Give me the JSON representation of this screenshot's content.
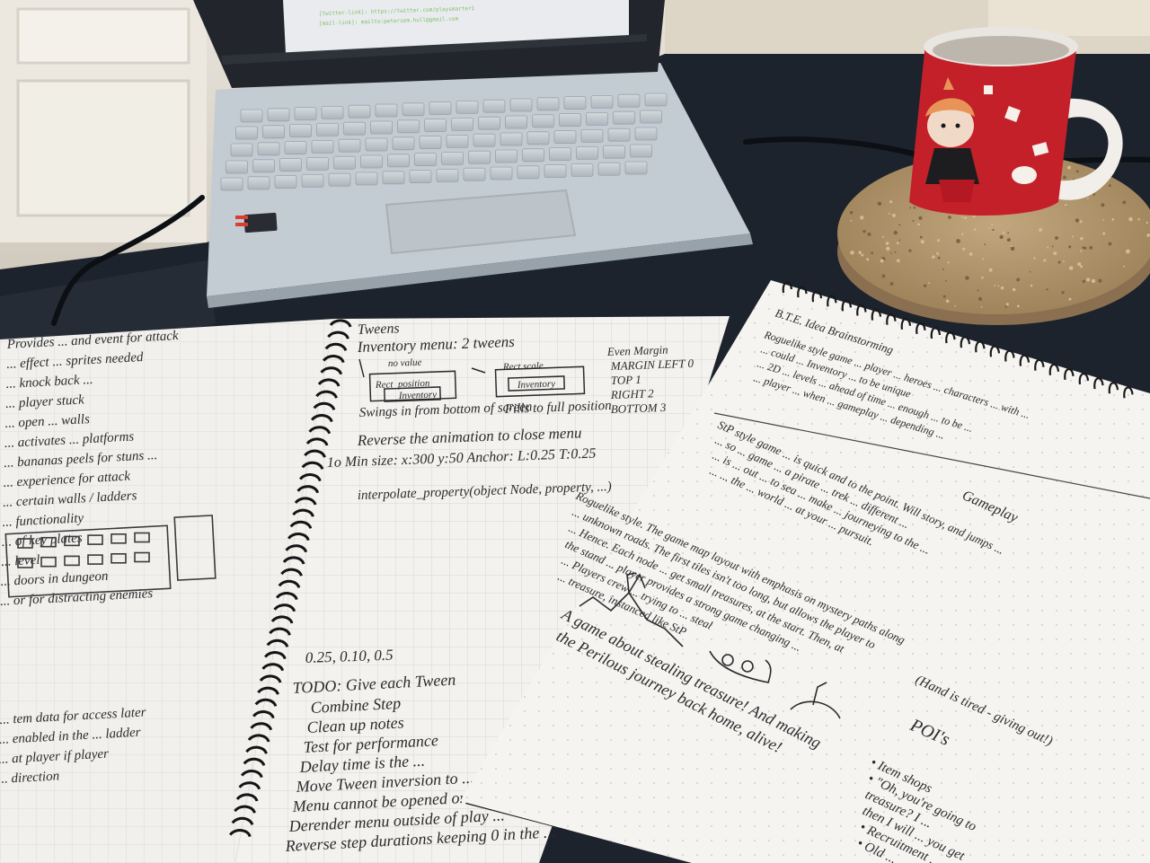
{
  "scene": {
    "description": "Photograph of a desk with a laptop, a red mug on a cork coaster, and two handwritten notebooks",
    "colors": {
      "desk": "#1d232c",
      "laptop": "#c4ccd3",
      "screen": "#22262c",
      "mug": "#c4202a",
      "cork": "#b2966e",
      "paper": "#f3f2ee",
      "ink": "#2b2b2e",
      "grid": "#c9ccd1"
    }
  },
  "laptop": {
    "screen_lines": [
      "[twitter-link]: https://twitter.com/playsmarter1",
      "[mail-link]: mailto:petersem.hull@gmail.com"
    ]
  },
  "middle_notebook": {
    "header_lines": [
      "Tweens",
      "Inventory menu: 2 tweens",
      "Swings in from bottom of screen",
      "Fills to full position",
      "Reverse the animation to close menu",
      "1o Min size: x:300 y:50  Anchor: L:0.25 T:0.25",
      "interpolate_property(object Node, property, ...)"
    ],
    "diagram_labels": [
      "no value",
      "Rect_position",
      "Inventory",
      "Rect scale",
      "Inventory"
    ],
    "margin_notes": [
      "Even Margin",
      "MARGIN LEFT 0",
      "TOP 1",
      "RIGHT 2",
      "BOTTOM 3"
    ],
    "number_lines": [
      "0.25, 0.10, 0.5"
    ],
    "todo_lines": [
      "TODO: Give each Tween",
      "Combine Step",
      "Clean up notes",
      "Test for performance",
      "Delay time is the ...",
      "Move Tween inversion to ...",
      "Menu cannot be opened or ...",
      "Derender menu outside of play ...",
      "Reverse step durations keeping 0 in the ..."
    ]
  },
  "left_notebook": {
    "lines": [
      "Provides ... and event for attack",
      "... effect ... sprites needed",
      "... knock back ...",
      "... player stuck",
      "... open ... walls",
      "... activates ... platforms",
      "... bananas peels for stuns ...",
      "... experience for attack",
      "... certain walls / ladders",
      "... functionality",
      "... of key plates",
      "... level",
      "... doors in dungeon",
      "... or for distracting enemies",
      "... tem data for access later",
      "... enabled in the ... ladder",
      "... at player if player",
      "... direction"
    ]
  },
  "right_notebook": {
    "title": "B.T.E. Idea  Brainstorming",
    "intro_lines": [
      "Roguelike style game ... player ... heroes ... characters ... with ...",
      "... could ... Inventory ... to be unique",
      "... 2D ... levels ... ahead of time ... enough ... to be ...",
      "... player ... when ... gameplay ... depending ..."
    ],
    "body_lines": [
      "StP style game ... is quick and to the point. Will story, and jumps ...",
      "... so ... game ... a pirate ... trek ... different ...",
      "... is ... out ... to sea ... make ... journeying to the ...",
      "... ... the ... world ... at your ... pursuit.",
      "Roguelike style. The game map layout with emphasis on mystery paths along",
      "... unknown roads. The first tiles isn't too long, but allows the player to",
      "... Hence. Each node ... get small treasures, at the start. Then, at",
      "the stand ... player provides a strong game changing ...",
      "... Players crew ... trying to ... steal",
      "... treasure, instanced like StP",
      "Gameplay"
    ],
    "bottom_lines": [
      "A game about stealing treasure! And making",
      "the Perilous journey back home, alive!"
    ],
    "poi_title": "POI's",
    "poi_lines": [
      "• Item shops",
      "• \"Oh, you're going to",
      "   treasure? I ...",
      "   then I will ... you get",
      "• Recruitment ...",
      "• Old ..."
    ],
    "hand_note": "(Hand is tired - giving out!)"
  }
}
